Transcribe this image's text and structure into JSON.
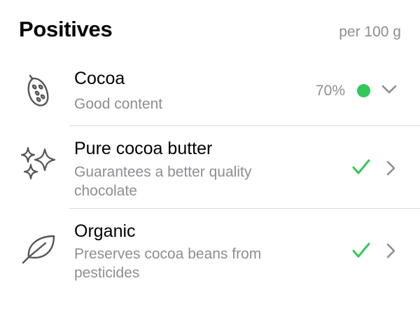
{
  "header": {
    "title": "Positives",
    "unit_label": "per 100 g"
  },
  "colors": {
    "accent_green": "#34c759",
    "secondary_text": "#8e8e93",
    "icon_stroke": "#555555"
  },
  "items": [
    {
      "icon": "cocoa-pod-icon",
      "title": "Cocoa",
      "subtitle": "Good content",
      "value": "70%",
      "status": "green-dot",
      "disclosure": "chevron-down-icon"
    },
    {
      "icon": "sparkles-icon",
      "title": "Pure cocoa butter",
      "subtitle": "Guarantees a better quality chocolate",
      "status": "check-icon",
      "disclosure": "chevron-right-icon"
    },
    {
      "icon": "leaf-icon",
      "title": "Organic",
      "subtitle": "Preserves cocoa beans from pesticides",
      "status": "check-icon",
      "disclosure": "chevron-right-icon"
    }
  ]
}
